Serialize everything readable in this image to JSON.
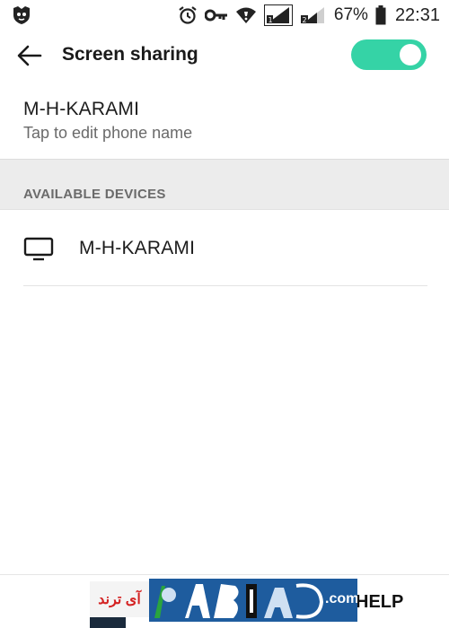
{
  "status_bar": {
    "battery": "67%",
    "time": "22:31",
    "sim1_label": "1",
    "sim2_label": "2",
    "icons": [
      "shield-app-icon",
      "alarm-icon",
      "vpn-key-icon",
      "wifi-icon",
      "signal-sim1-icon",
      "signal-sim2-icon",
      "battery-icon"
    ]
  },
  "app_bar": {
    "title": "Screen sharing",
    "toggle_on": true,
    "accent_color": "#35d3a6"
  },
  "phone": {
    "name": "M-H-KARAMI",
    "subtitle": "Tap to edit phone name"
  },
  "section": {
    "label": "AVAILABLE DEVICES"
  },
  "devices": [
    {
      "name": "M-H-KARAMI",
      "icon": "tv-icon"
    }
  ],
  "bottom": {
    "help_label": "HELP"
  },
  "watermark": {
    "persian_text": "آی ترند",
    "logo_domain": ".com"
  }
}
